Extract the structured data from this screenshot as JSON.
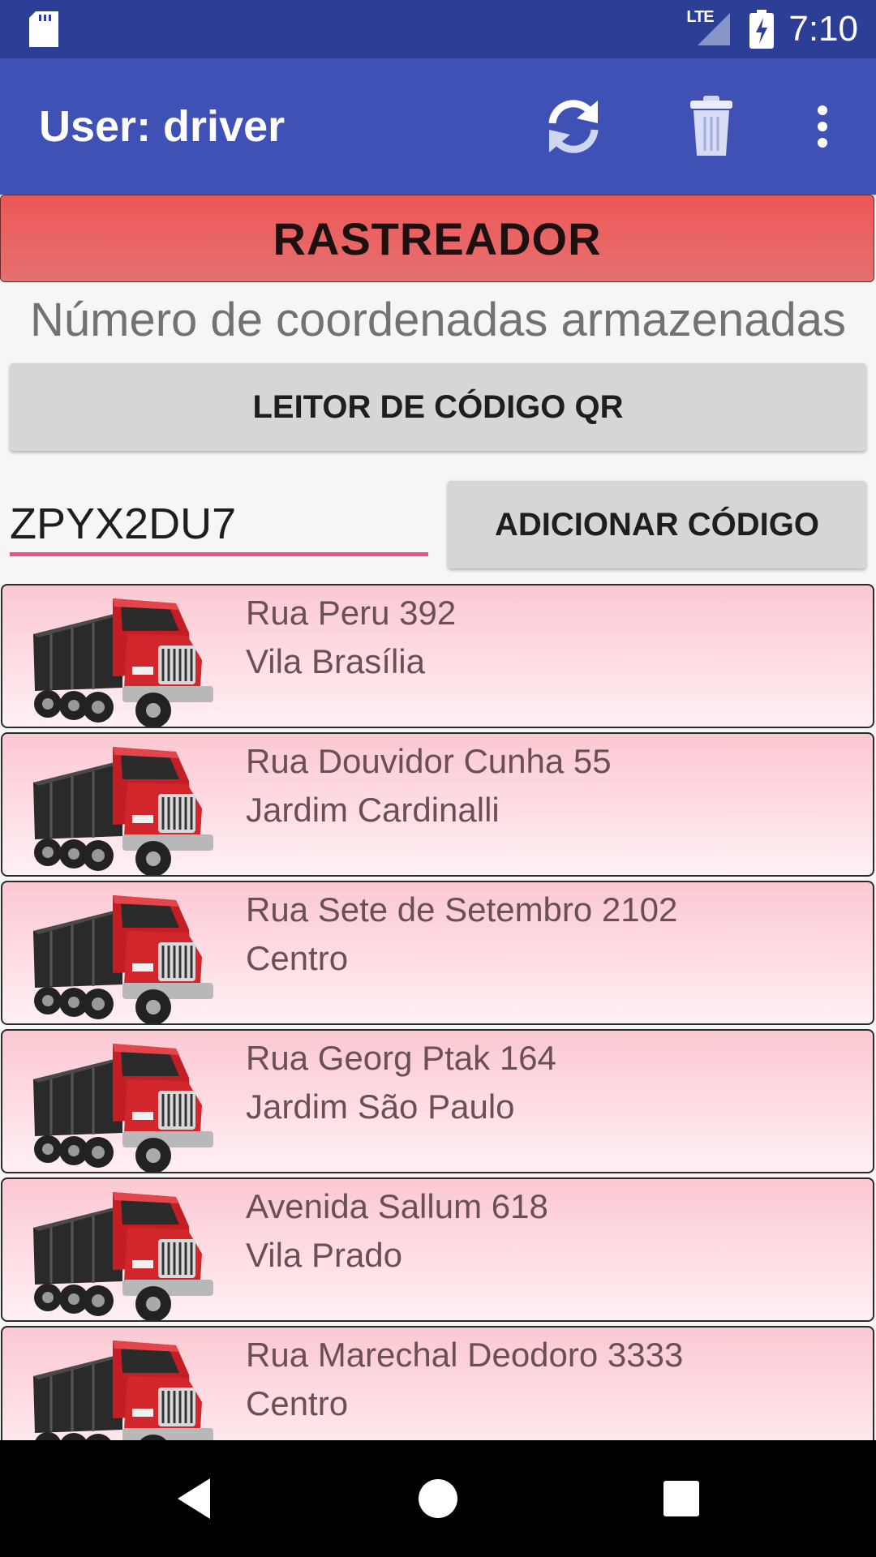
{
  "status_bar": {
    "network_label": "LTE",
    "time": "7:10"
  },
  "app_bar": {
    "title": "User: driver",
    "actions": [
      "refresh-icon",
      "trash-icon",
      "overflow-menu-icon"
    ]
  },
  "banner": {
    "label": "RASTREADOR"
  },
  "coords_label": "Número de coordenadas armazenadas",
  "qr_button_label": "LEITOR DE CÓDIGO QR",
  "code_input": {
    "value": "ZPYX2DU7"
  },
  "add_button_label": "ADICIONAR CÓDIGO",
  "deliveries": [
    {
      "street": "Rua Peru 392",
      "district": "Vila Brasília"
    },
    {
      "street": "Rua Douvidor Cunha 55",
      "district": "Jardim Cardinalli"
    },
    {
      "street": "Rua Sete de Setembro 2102",
      "district": "Centro"
    },
    {
      "street": "Rua Georg Ptak 164",
      "district": "Jardim São Paulo"
    },
    {
      "street": "Avenida Sallum 618",
      "district": "Vila Prado"
    },
    {
      "street": "Rua Marechal Deodoro 3333",
      "district": "Centro"
    }
  ],
  "colors": {
    "status_bar": "#2d3e96",
    "app_bar": "#3f51b5",
    "banner": "#ee5757",
    "input_underline": "#f04f82",
    "list_item": "#fcc8d2"
  },
  "nav_bar": [
    "back-icon",
    "home-icon",
    "recents-icon"
  ]
}
